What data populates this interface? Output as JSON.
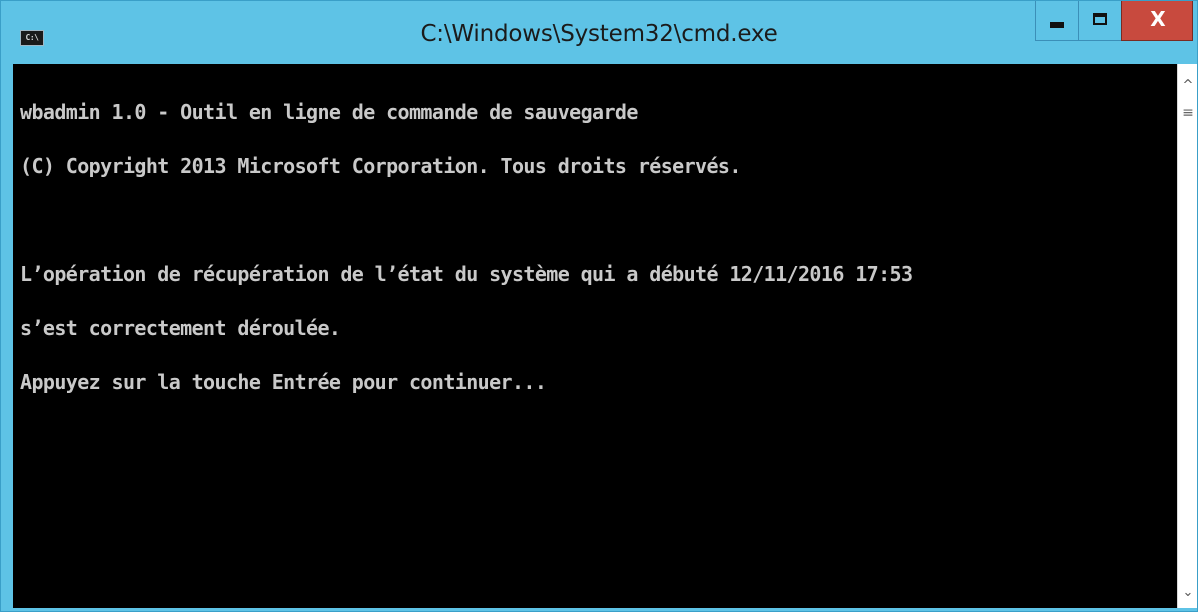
{
  "window": {
    "title": "C:\\Windows\\System32\\cmd.exe",
    "app_icon": "cmd-icon",
    "app_icon_text": "C:\\",
    "controls": {
      "minimize_icon": "minimize-icon",
      "maximize_icon": "maximize-icon",
      "close_icon": "close-icon",
      "close_label": "X"
    },
    "colors": {
      "titlebar": "#5ec3e6",
      "close_button": "#c84a3e",
      "console_bg": "#000000",
      "console_text": "#c9c9c9"
    }
  },
  "console": {
    "lines": [
      "wbadmin 1.0 - Outil en ligne de commande de sauvegarde",
      "(C) Copyright 2013 Microsoft Corporation. Tous droits réservés.",
      "",
      "L’opération de récupération de l’état du système qui a débuté 12/11/2016 17:53",
      "s’est correctement déroulée.",
      "Appuyez sur la touche Entrée pour continuer..."
    ]
  },
  "scrollbar": {
    "up_icon": "scroll-up-icon",
    "up_glyph": "^",
    "thumb_icon": "scroll-thumb-grip-icon",
    "thumb_glyph": "≡",
    "down_icon": "scroll-down-icon",
    "down_glyph": "⌄"
  }
}
